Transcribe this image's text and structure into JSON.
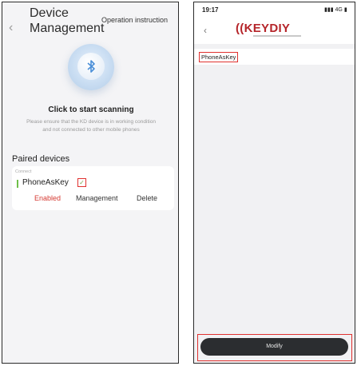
{
  "left_screen": {
    "title": "Device Management",
    "operation_instruction": "Operation instruction",
    "scan_title": "Click to start scanning",
    "scan_description": "Please ensure that the KD device is in working condition and not connected to other mobile phones",
    "paired_header": "Paired devices",
    "device": {
      "status": "Connect",
      "name": "PhoneAsKey",
      "actions": {
        "enabled": "Enabled",
        "management": "Management",
        "delete": "Delete"
      }
    }
  },
  "right_screen": {
    "time": "19:17",
    "status": "4G",
    "logo": "KEYDIY",
    "device_name_value": "PhoneAsKey",
    "modify_label": "Modify"
  },
  "colors": {
    "highlight_red": "#e0312f",
    "enabled_red": "#d53a32",
    "brand_red": "#b5252a",
    "button_dark": "#2b2d30"
  }
}
